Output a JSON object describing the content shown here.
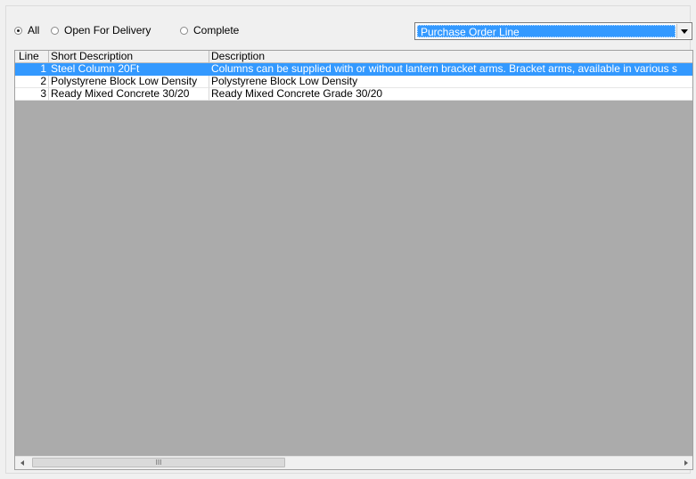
{
  "filters": {
    "options": [
      {
        "label": "All",
        "selected": true
      },
      {
        "label": "Open For Delivery",
        "selected": false
      },
      {
        "label": "Complete",
        "selected": false
      }
    ]
  },
  "view_selector": {
    "value": "Purchase Order Line"
  },
  "grid": {
    "columns": [
      "Line",
      "Short Description",
      "Description"
    ],
    "rows": [
      {
        "line": "1",
        "short": "Steel Column 20Ft",
        "desc": "Columns can be supplied with or without lantern bracket arms. Bracket arms, available in various s",
        "selected": true
      },
      {
        "line": "2",
        "short": "Polystyrene Block Low Density",
        "desc": "Polystyrene Block Low Density",
        "selected": false
      },
      {
        "line": "3",
        "short": "Ready Mixed Concrete 30/20",
        "desc": "Ready Mixed Concrete Grade 30/20",
        "selected": false
      }
    ],
    "scroll_grip": "III"
  },
  "colors": {
    "selection": "#3399ff",
    "empty_area": "#ababab"
  }
}
